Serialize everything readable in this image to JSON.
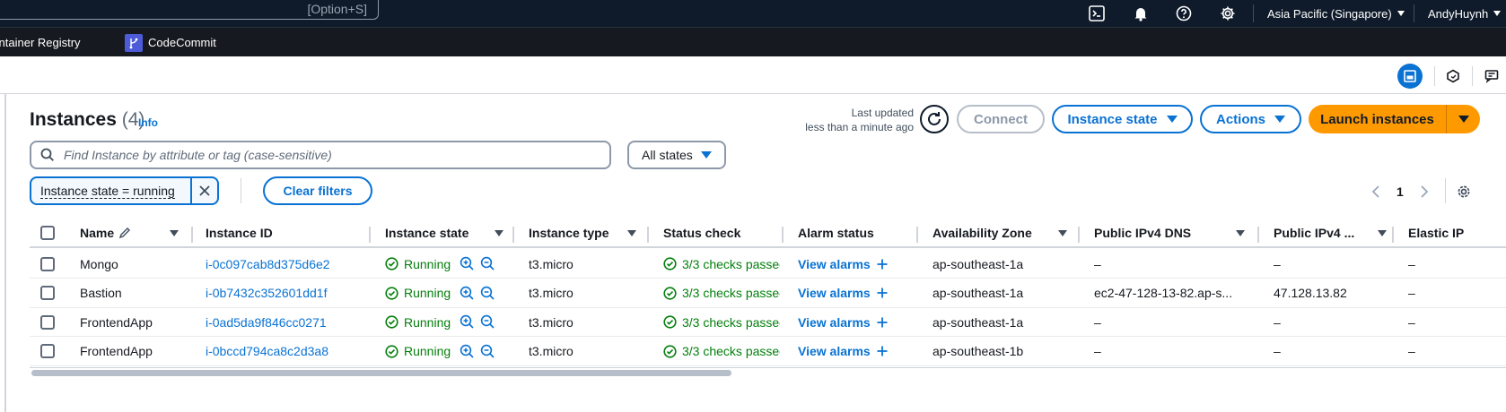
{
  "topnav": {
    "search_shortcut": "[Option+S]",
    "region": "Asia Pacific (Singapore)",
    "user": "AndyHuynh"
  },
  "favorites": [
    {
      "label": "Elastic Container Registry"
    },
    {
      "label": "CodeCommit"
    }
  ],
  "header": {
    "title": "Instances",
    "count": "(4)",
    "info": "Info",
    "last_updated_1": "Last updated",
    "last_updated_2": "less than a minute ago"
  },
  "buttons": {
    "connect": "Connect",
    "instance_state": "Instance state",
    "actions": "Actions",
    "launch": "Launch instances",
    "clear_filters": "Clear filters"
  },
  "filter": {
    "placeholder": "Find Instance by attribute or tag (case-sensitive)",
    "states_select": "All states",
    "token": "Instance state = running"
  },
  "pagination": {
    "page": "1"
  },
  "columns": {
    "name": "Name",
    "instance_id": "Instance ID",
    "instance_state": "Instance state",
    "instance_type": "Instance type",
    "status_check": "Status check",
    "alarm_status": "Alarm status",
    "az": "Availability Zone",
    "ipv4_dns": "Public IPv4 DNS",
    "ipv4": "Public IPv4 ...",
    "elastic_ip": "Elastic IP"
  },
  "rows": [
    {
      "name": "Mongo",
      "id": "i-0c097cab8d375d6e2",
      "state": "Running",
      "type": "t3.micro",
      "status": "3/3 checks passed",
      "alarm": "View alarms",
      "az": "ap-southeast-1a",
      "dns": "–",
      "ip": "–",
      "eip": "–"
    },
    {
      "name": "Bastion",
      "id": "i-0b7432c352601dd1f",
      "state": "Running",
      "type": "t3.micro",
      "status": "3/3 checks passed",
      "alarm": "View alarms",
      "az": "ap-southeast-1a",
      "dns": "ec2-47-128-13-82.ap-s...",
      "ip": "47.128.13.82",
      "eip": "–"
    },
    {
      "name": "FrontendApp",
      "id": "i-0ad5da9f846cc0271",
      "state": "Running",
      "type": "t3.micro",
      "status": "3/3 checks passed",
      "alarm": "View alarms",
      "az": "ap-southeast-1a",
      "dns": "–",
      "ip": "–",
      "eip": "–"
    },
    {
      "name": "FrontendApp",
      "id": "i-0bccd794ca8c2d3a8",
      "state": "Running",
      "type": "t3.micro",
      "status": "3/3 checks passed",
      "alarm": "View alarms",
      "az": "ap-southeast-1b",
      "dns": "–",
      "ip": "–",
      "eip": "–"
    }
  ],
  "colors": {
    "nav_bg": "#0f1b2a",
    "link": "#0972d3",
    "running_green": "#037f0c",
    "launch_orange": "#ff9900"
  }
}
